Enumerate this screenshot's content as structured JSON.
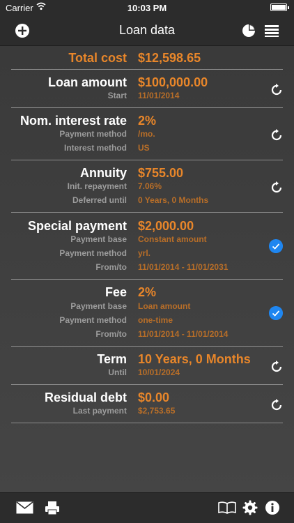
{
  "status": {
    "carrier": "Carrier",
    "time": "10:03 PM"
  },
  "nav": {
    "title": "Loan data"
  },
  "rows": {
    "total": {
      "label": "Total cost",
      "value": "$12,598.65"
    },
    "loan": {
      "label": "Loan amount",
      "value": "$100,000.00",
      "sub1_label": "Start",
      "sub1_value": "11/01/2014"
    },
    "interest": {
      "label": "Nom. interest rate",
      "value": "2%",
      "sub1_label": "Payment method",
      "sub1_value": "/mo.",
      "sub2_label": "Interest method",
      "sub2_value": "US"
    },
    "annuity": {
      "label": "Annuity",
      "value": "$755.00",
      "sub1_label": "Init. repayment",
      "sub1_value": "7.06%",
      "sub2_label": "Deferred until",
      "sub2_value": "0 Years, 0 Months"
    },
    "special": {
      "label": "Special payment",
      "value": "$2,000.00",
      "sub1_label": "Payment base",
      "sub1_value": "Constant amount",
      "sub2_label": "Payment method",
      "sub2_value": "yrl.",
      "sub3_label": "From/to",
      "sub3_value": "11/01/2014 - 11/01/2031"
    },
    "fee": {
      "label": "Fee",
      "value": "2%",
      "sub1_label": "Payment base",
      "sub1_value": "Loan amount",
      "sub2_label": "Payment method",
      "sub2_value": "one-time",
      "sub3_label": "From/to",
      "sub3_value": "11/01/2014 - 11/01/2014"
    },
    "term": {
      "label": "Term",
      "value": "10 Years, 0 Months",
      "sub1_label": "Until",
      "sub1_value": "10/01/2024"
    },
    "residual": {
      "label": "Residual debt",
      "value": "$0.00",
      "sub1_label": "Last payment",
      "sub1_value": "$2,753.65"
    }
  },
  "colors": {
    "accent": "#e8862a",
    "check": "#1f86f0"
  },
  "icons": [
    "wifi-icon",
    "battery-icon",
    "add-icon",
    "pie-chart-icon",
    "list-icon",
    "refresh-icon",
    "checkmark-icon",
    "mail-icon",
    "print-icon",
    "book-icon",
    "gear-icon",
    "info-icon"
  ]
}
